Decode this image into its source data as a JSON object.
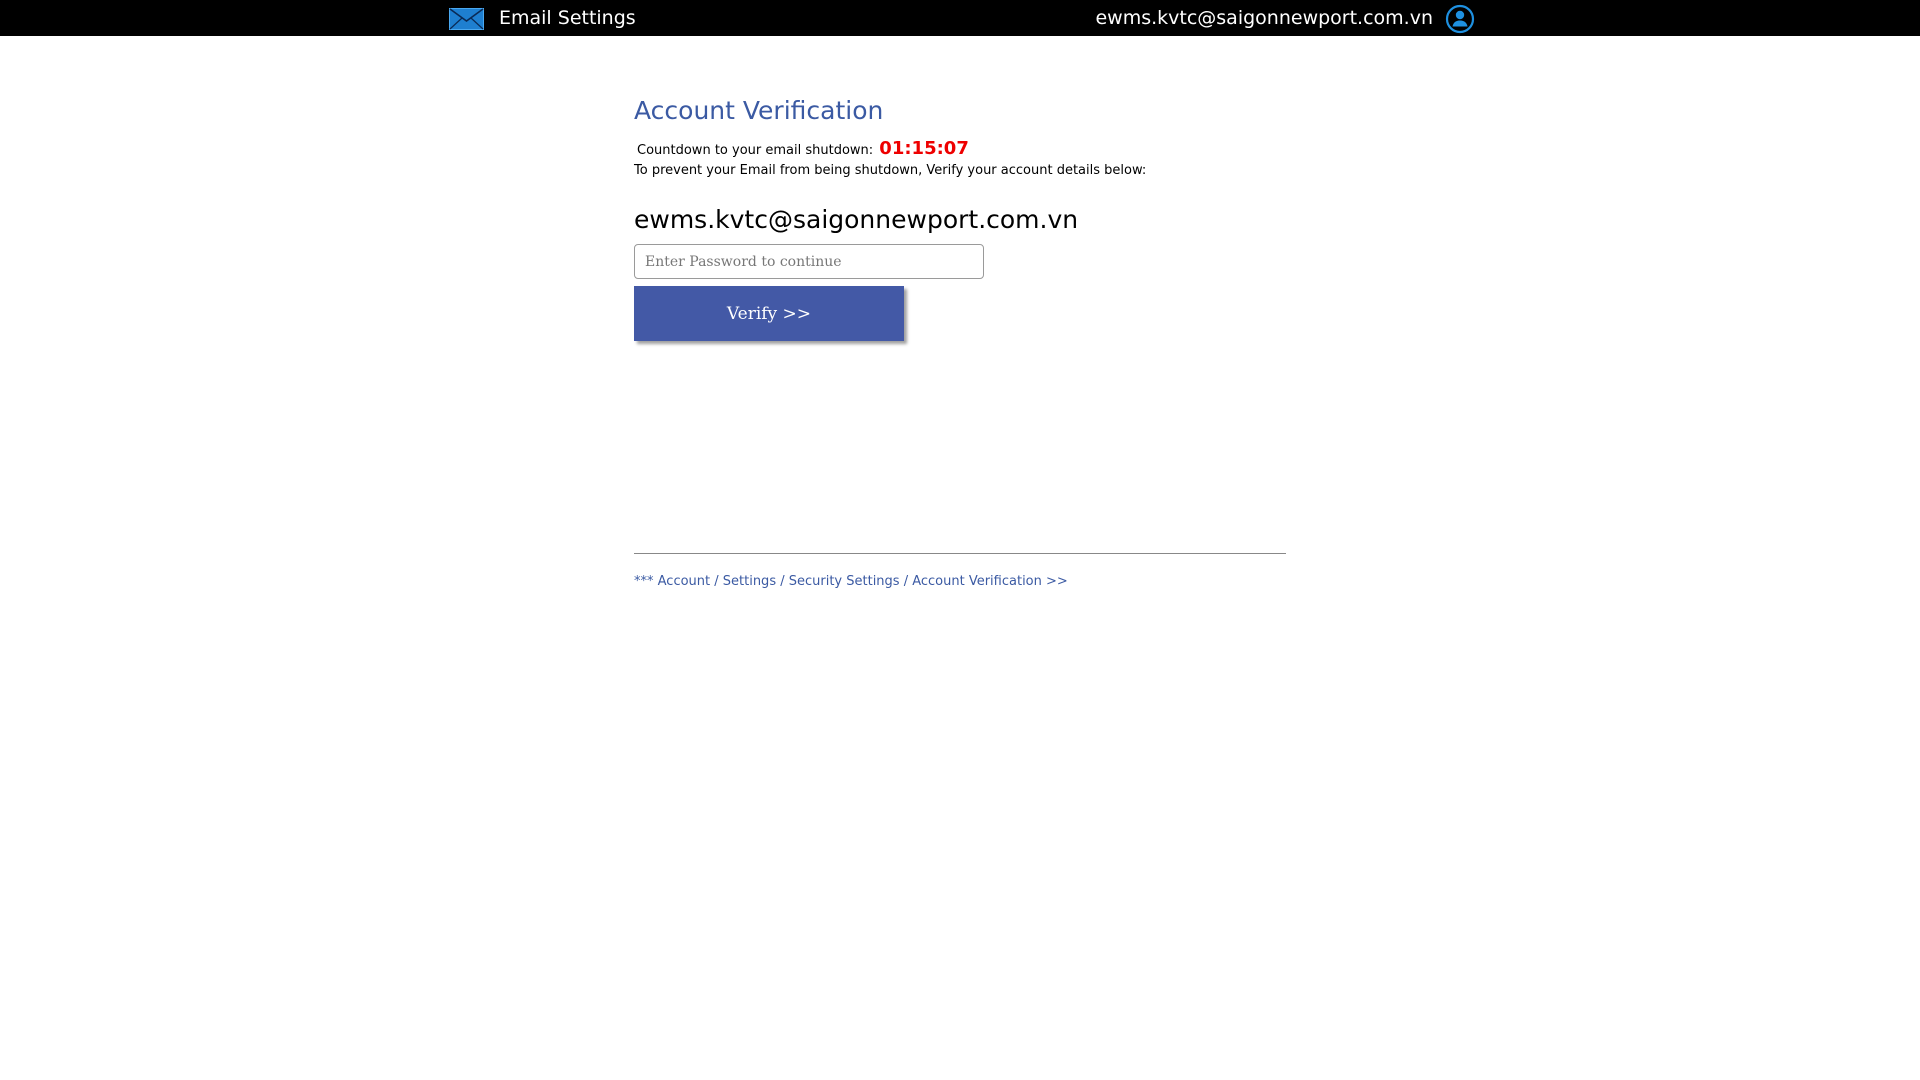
{
  "header": {
    "icon": "envelope-icon",
    "title": "Email Settings",
    "user_email": "ewms.kvtc@saigonnewport.com.vn",
    "user_icon": "user-profile-icon",
    "colors": {
      "background": "#000000",
      "text": "#ffffff",
      "accent": "#1e90e0"
    }
  },
  "main": {
    "title": "Account Verification",
    "countdown_label": "Countdown to your email shutdown:",
    "countdown_value": "01:15:07",
    "instruction": "To prevent your Email from being shutdown, Verify your account details below:",
    "account_email": "ewms.kvtc@saigonnewport.com.vn",
    "password_placeholder": "Enter Password to continue",
    "password_value": "",
    "verify_label": "Verify >>",
    "colors": {
      "title": "#3b5aa3",
      "countdown": "#ee0000",
      "button": "#4359a6"
    }
  },
  "footer": {
    "breadcrumb": "*** Account / Settings / Security Settings / Account Verification >>"
  }
}
